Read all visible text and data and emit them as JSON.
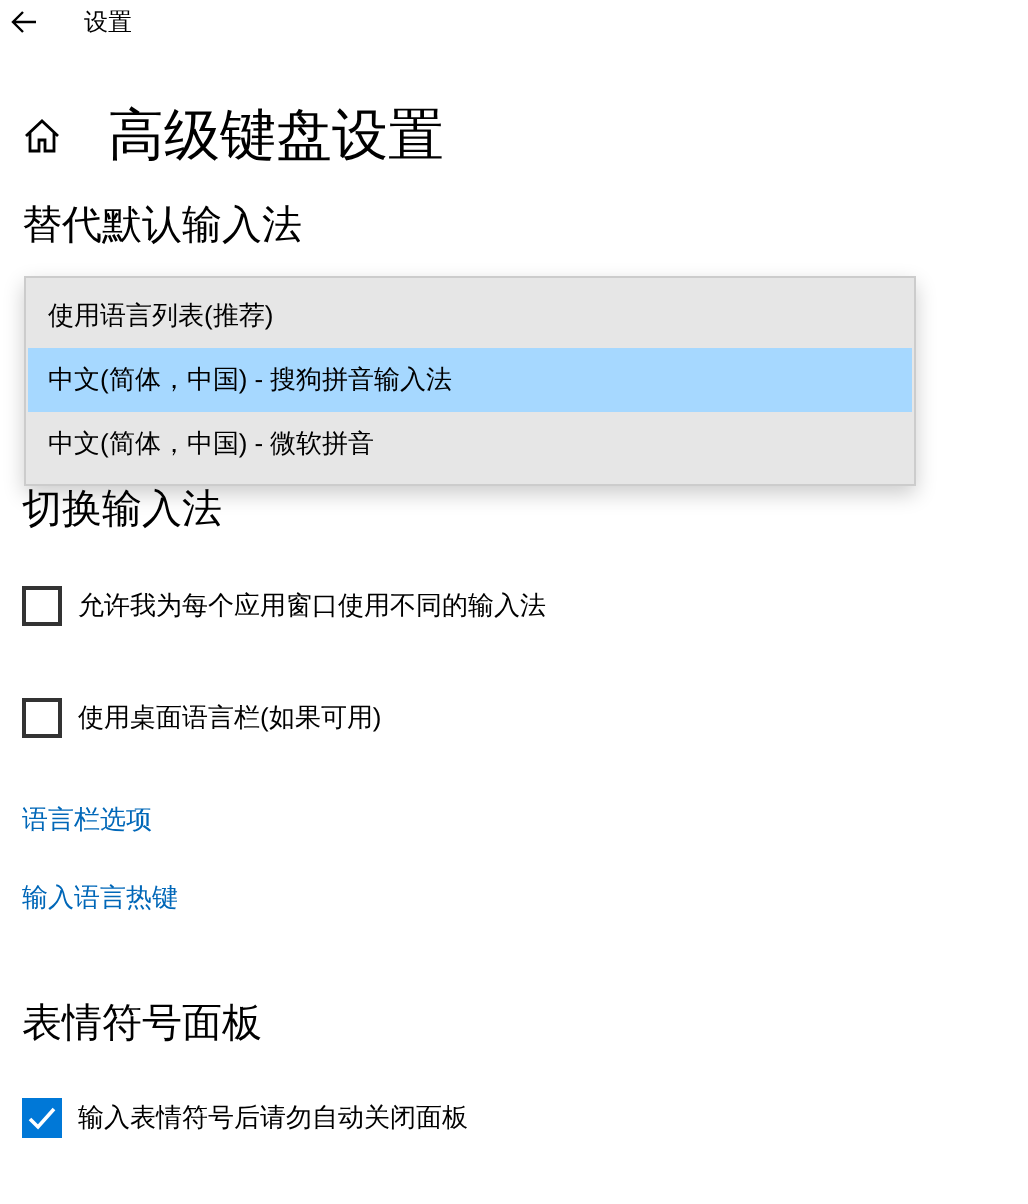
{
  "window": {
    "title": "设置"
  },
  "page": {
    "title": "高级键盘设置"
  },
  "override": {
    "heading": "替代默认输入法",
    "options": [
      {
        "label": "使用语言列表(推荐)",
        "selected": false
      },
      {
        "label": "中文(简体，中国) - 搜狗拼音输入法",
        "selected": true
      },
      {
        "label": "中文(简体，中国) - 微软拼音",
        "selected": false
      }
    ]
  },
  "switching": {
    "heading": "切换输入法",
    "options": [
      {
        "label": "允许我为每个应用窗口使用不同的输入法",
        "checked": false
      },
      {
        "label": "使用桌面语言栏(如果可用)",
        "checked": false
      }
    ]
  },
  "links": [
    "语言栏选项",
    "输入语言热键"
  ],
  "emoji": {
    "heading": "表情符号面板",
    "options": [
      {
        "label": "输入表情符号后请勿自动关闭面板",
        "checked": true
      }
    ]
  }
}
